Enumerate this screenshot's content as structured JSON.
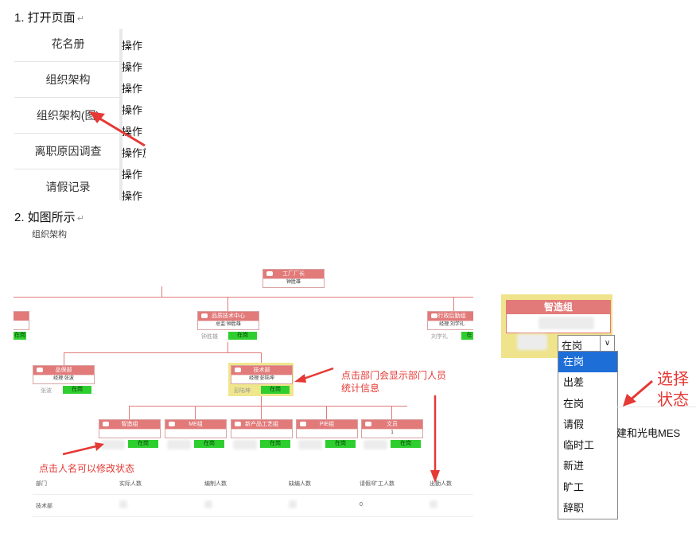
{
  "steps": [
    "1.  打开页面",
    "2.  如图所示"
  ],
  "paragraph_mark": "↵",
  "menu": [
    "花名册",
    "组织架构",
    "组织架构(图)",
    "离职原因调查",
    "请假记录"
  ],
  "ops": [
    "操作",
    "操作",
    "操作",
    "操作",
    "操作",
    "操作旅",
    "操作",
    "操作",
    "操作↵"
  ],
  "subtitle": "组织架构",
  "chart": {
    "top": {
      "title": "工厂厂长",
      "mgr": "钟胜雄"
    },
    "left_cut": {
      "badge": "在岗"
    },
    "center": {
      "title": "品质技术中心",
      "mgr": "总监:钟胜雄",
      "person": "钟胜雄",
      "badge": "在岗"
    },
    "right": {
      "title": "行政后勤组",
      "mgr": "经理:刘学礼",
      "person": "刘学礼",
      "badge": "在"
    },
    "quality": {
      "title": "品保部",
      "mgr": "经理:张波",
      "person": "张波",
      "badge": "在岗"
    },
    "tech": {
      "title": "技术部",
      "mgr": "经理:彭陆坤",
      "person": "彭陆坤",
      "badge": "在岗"
    },
    "teams": [
      {
        "title": "智造组",
        "badge": "在岗"
      },
      {
        "title": "ME组",
        "badge": "在岗"
      },
      {
        "title": "新产品工艺组",
        "badge": "在岗"
      },
      {
        "title": "PIE组",
        "badge": "在岗"
      },
      {
        "title": "文员",
        "mgr": "1",
        "badge": "在岗"
      }
    ],
    "note_dept": "点击部门会显示部门人员\n统计信息",
    "note_person": "点击人名可以修改状态",
    "stats_headers": [
      "部门",
      "实际人数",
      "编制人数",
      "缺编人数",
      "请假/旷工人数",
      "出勤人数"
    ],
    "stats_row": {
      "dept": "技术部",
      "leave": "0"
    }
  },
  "dropdown": {
    "card_title": "智造组",
    "selected": "在岗",
    "options": [
      "在岗",
      "出差",
      "在岗",
      "请假",
      "临时工",
      "新进",
      "旷工",
      "辞职"
    ],
    "note": "选择\n状态",
    "trailing_text": "建和光电MES"
  }
}
